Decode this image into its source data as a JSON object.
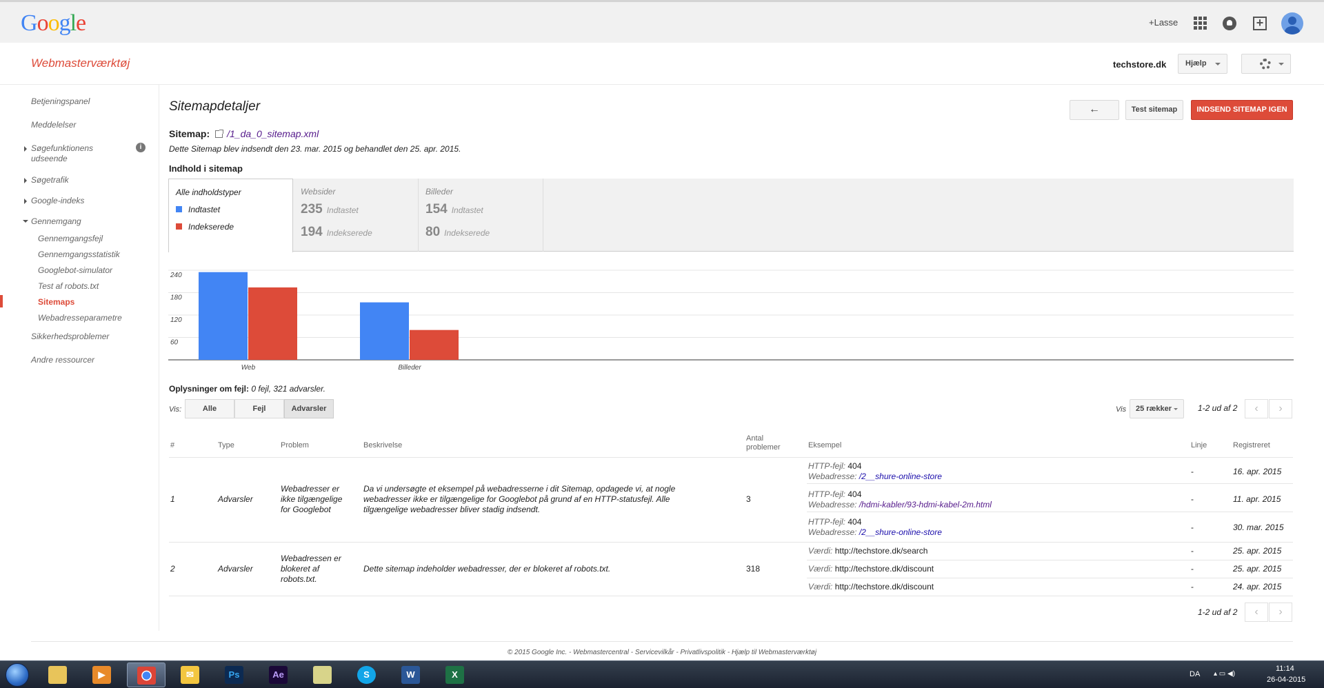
{
  "google_bar": {
    "logo": "Google",
    "user": "+Lasse"
  },
  "header": {
    "product_title": "Webmasterværktøj",
    "site": "techstore.dk",
    "help_label": "Hjælp"
  },
  "sidebar": {
    "items": [
      {
        "label": "Betjeningspanel"
      },
      {
        "label": "Meddelelser"
      },
      {
        "label": "Søgefunktionens udseende"
      },
      {
        "label": "Søgetrafik"
      },
      {
        "label": "Google-indeks"
      },
      {
        "label": "Gennemgang"
      },
      {
        "label": "Sikkerhedsproblemer"
      },
      {
        "label": "Andre ressourcer"
      }
    ],
    "sub_items": [
      {
        "label": "Gennemgangsfejl"
      },
      {
        "label": "Gennemgangsstatistik"
      },
      {
        "label": "Googlebot-simulator"
      },
      {
        "label": "Test af robots.txt"
      },
      {
        "label": "Sitemaps"
      },
      {
        "label": "Webadresseparametre"
      }
    ]
  },
  "main": {
    "title": "Sitemapdetaljer",
    "back_label": "←",
    "test_label": "Test sitemap",
    "submit_label": "INDSEND SITEMAP IGEN",
    "sitemap_label": "Sitemap:",
    "sitemap_url": "/1_da_0_sitemap.xml",
    "sitemap_desc": "Dette Sitemap blev indsendt den 23. mar. 2015 og behandlet den 25. apr. 2015.",
    "content_heading": "Indhold i sitemap"
  },
  "content_tabs": {
    "all": {
      "name": "Alle indholdstyper",
      "legend_submitted": "Indtastet",
      "legend_indexed": "Indekserede"
    },
    "web": {
      "name": "Websider",
      "submitted": "235",
      "submitted_label": "Indtastet",
      "indexed": "194",
      "indexed_label": "Indekserede"
    },
    "images": {
      "name": "Billeder",
      "submitted": "154",
      "submitted_label": "Indtastet",
      "indexed": "80",
      "indexed_label": "Indekserede"
    }
  },
  "colors": {
    "submitted": "#4285f4",
    "indexed": "#dd4b39",
    "accent": "#dd4b39"
  },
  "chart_data": {
    "type": "bar",
    "categories": [
      "Web",
      "Billeder"
    ],
    "series": [
      {
        "name": "Indtastet",
        "values": [
          235,
          154
        ]
      },
      {
        "name": "Indekserede",
        "values": [
          194,
          80
        ]
      }
    ],
    "yticks": [
      "240",
      "180",
      "120",
      "60"
    ],
    "ylim": [
      0,
      240
    ]
  },
  "errors": {
    "label": "Oplysninger om fejl:",
    "summary": "0 fejl, 321 advarsler.",
    "vis_label": "Vis:",
    "filters": [
      "Alle",
      "Fejl",
      "Advarsler"
    ],
    "rows_label": "Vis",
    "rows_value": "25 rækker",
    "pager": "1-2 ud af 2"
  },
  "table": {
    "headers": {
      "num": "#",
      "type": "Type",
      "problem": "Problem",
      "desc": "Beskrivelse",
      "count_1": "Antal",
      "count_2": "problemer",
      "example": "Eksempel",
      "line": "Linje",
      "registered": "Registreret"
    },
    "rows": [
      {
        "num": "1",
        "type": "Advarsler",
        "problem_1": "Webadresser er",
        "problem_2": "ikke tilgængelige",
        "problem_3": "for Googlebot",
        "desc_1": "Da vi undersøgte et eksempel på webadresserne i dit Sitemap, opdagede vi, at nogle",
        "desc_2": "webadresser ikke er tilgængelige for Googlebot på grund af en HTTP-statusfejl. Alle",
        "desc_3": "tilgængelige webadresser bliver stadig indsendt.",
        "count": "3",
        "examples": [
          {
            "k1": "HTTP-fejl:",
            "v1": "404",
            "k2": "Webadresse:",
            "v2": "/2__shure-online-store",
            "line": "-",
            "date": "16. apr. 2015"
          },
          {
            "k1": "HTTP-fejl:",
            "v1": "404",
            "k2": "Webadresse:",
            "v2": "/hdmi-kabler/93-hdmi-kabel-2m.html",
            "line": "-",
            "date": "11. apr. 2015"
          },
          {
            "k1": "HTTP-fejl:",
            "v1": "404",
            "k2": "Webadresse:",
            "v2": "/2__shure-online-store",
            "line": "-",
            "date": "30. mar. 2015"
          }
        ]
      },
      {
        "num": "2",
        "type": "Advarsler",
        "problem_1": "Webadressen er",
        "problem_2": "blokeret af",
        "problem_3": "robots.txt.",
        "desc_1": "Dette sitemap indeholder webadresser, der er blokeret af robots.txt.",
        "count": "318",
        "examples": [
          {
            "k1": "Værdi:",
            "v1": "http://techstore.dk/search",
            "line": "-",
            "date": "25. apr. 2015"
          },
          {
            "k1": "Værdi:",
            "v1": "http://techstore.dk/discount",
            "line": "-",
            "date": "25. apr. 2015"
          },
          {
            "k1": "Værdi:",
            "v1": "http://techstore.dk/discount",
            "line": "-",
            "date": "24. apr. 2015"
          }
        ]
      }
    ]
  },
  "footer": {
    "text": "© 2015 Google Inc. - Webmastercentral - Servicevilkår - Privatlivspolitik - Hjælp til Webmasterværktøj"
  },
  "taskbar": {
    "lang": "DA",
    "time": "11:14",
    "date": "26-04-2015",
    "apps": [
      "explorer-icon",
      "media-player-icon",
      "chrome-icon",
      "outlook-icon",
      "photoshop-icon",
      "after-effects-icon",
      "folder-icon",
      "skype-icon",
      "word-icon",
      "excel-icon"
    ]
  }
}
